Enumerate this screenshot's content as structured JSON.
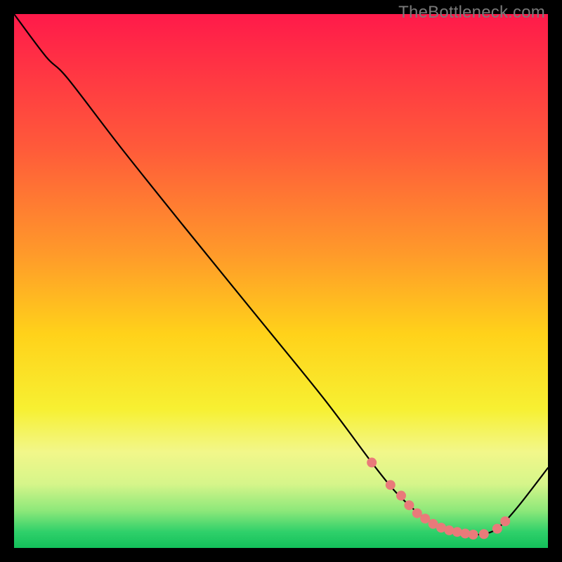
{
  "watermark": "TheBottleneck.com",
  "chart_data": {
    "type": "line",
    "title": "",
    "xlabel": "",
    "ylabel": "",
    "xlim": [
      0,
      100
    ],
    "ylim": [
      0,
      100
    ],
    "grid": false,
    "legend": false,
    "gradient_stops": [
      {
        "offset": 0.0,
        "color": "#ff1a4a"
      },
      {
        "offset": 0.25,
        "color": "#ff5a3a"
      },
      {
        "offset": 0.45,
        "color": "#ff9a2a"
      },
      {
        "offset": 0.6,
        "color": "#ffd21a"
      },
      {
        "offset": 0.74,
        "color": "#f7f032"
      },
      {
        "offset": 0.82,
        "color": "#f2f78a"
      },
      {
        "offset": 0.88,
        "color": "#d6f58a"
      },
      {
        "offset": 0.93,
        "color": "#8de87a"
      },
      {
        "offset": 0.97,
        "color": "#2fd06a"
      },
      {
        "offset": 1.0,
        "color": "#13c05a"
      }
    ],
    "series": [
      {
        "name": "bottleneck-curve",
        "color": "#000000",
        "x": [
          0.0,
          6.0,
          10.0,
          20.0,
          32.0,
          45.0,
          58.0,
          67.0,
          71.0,
          74.0,
          77.0,
          80.0,
          82.0,
          84.0,
          86.0,
          88.0,
          90.0,
          92.0,
          95.0,
          100.0
        ],
        "y": [
          100.0,
          92.0,
          88.0,
          75.0,
          60.0,
          44.0,
          28.0,
          16.0,
          11.0,
          8.0,
          5.5,
          3.8,
          3.0,
          2.6,
          2.5,
          2.6,
          3.3,
          5.0,
          8.5,
          15.0
        ]
      }
    ],
    "markers": {
      "name": "bottom-range-dots",
      "color": "#e97a7a",
      "radius_px": 7,
      "x": [
        67.0,
        70.5,
        72.5,
        74.0,
        75.5,
        77.0,
        78.5,
        80.0,
        81.5,
        83.0,
        84.5,
        86.0,
        88.0,
        90.5,
        92.0
      ],
      "y": [
        16.0,
        11.8,
        9.8,
        8.0,
        6.5,
        5.5,
        4.5,
        3.8,
        3.3,
        3.0,
        2.7,
        2.5,
        2.6,
        3.6,
        5.0
      ]
    }
  }
}
